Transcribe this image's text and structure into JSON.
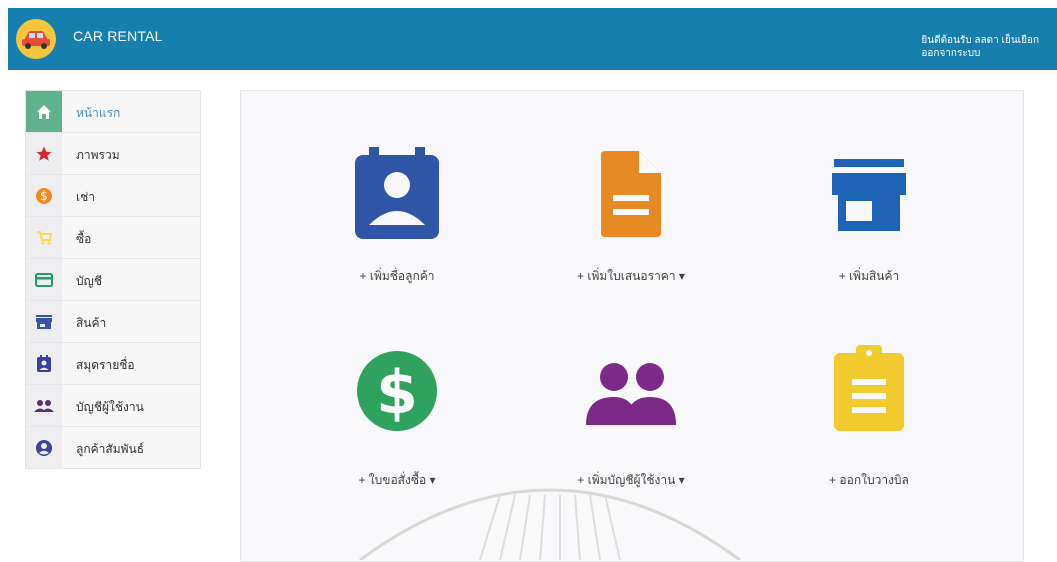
{
  "header": {
    "brand": "CAR RENTAL",
    "welcome": "ยินดีต้อนรับ ลลดา เย็นเยือก",
    "logout": "ออกจากระบบ",
    "color": "#177fae"
  },
  "sidebar": {
    "items": [
      {
        "label": "หน้าแรก",
        "icon": "home-icon",
        "color": "#ffffff"
      },
      {
        "label": "ภาพรวม",
        "icon": "star-icon",
        "color": "#d7282f"
      },
      {
        "label": "เช่า",
        "icon": "dollar-icon",
        "color": "#f08a24"
      },
      {
        "label": "ซื้อ",
        "icon": "cart-icon",
        "color": "#f4e04d"
      },
      {
        "label": "บัญชี",
        "icon": "credit-card-icon",
        "color": "#1e9e6a"
      },
      {
        "label": "สินค้า",
        "icon": "store-icon",
        "color": "#3455a5"
      },
      {
        "label": "สมุดรายชื่อ",
        "icon": "contacts-icon",
        "color": "#3c3f9b"
      },
      {
        "label": "บัญชีผู้ใช้งาน",
        "icon": "users-icon",
        "color": "#5a2d79"
      },
      {
        "label": "ลูกค้าสัมพันธ์",
        "icon": "account-icon",
        "color": "#3c3f9b"
      }
    ]
  },
  "tiles": [
    {
      "label": "+ เพิ่มชื่อลูกค้า",
      "icon": "contact-card-icon",
      "color": "#2f55a7"
    },
    {
      "label": "+ เพิ่มใบเสนอราคา ▾",
      "icon": "document-icon",
      "color": "#e78a24"
    },
    {
      "label": "+ เพิ่มสินค้า",
      "icon": "store-icon",
      "color": "#1e63b5"
    },
    {
      "label": "+ ใบขอสั่งซื้อ ▾",
      "icon": "dollar-circle-icon",
      "color": "#2fa25d"
    },
    {
      "label": "+ เพิ่มบัญชีผู้ใช้งาน ▾",
      "icon": "users-icon",
      "color": "#7b2a87"
    },
    {
      "label": "+ ออกใบวางบิล",
      "icon": "clipboard-icon",
      "color": "#f2cc2e"
    }
  ]
}
